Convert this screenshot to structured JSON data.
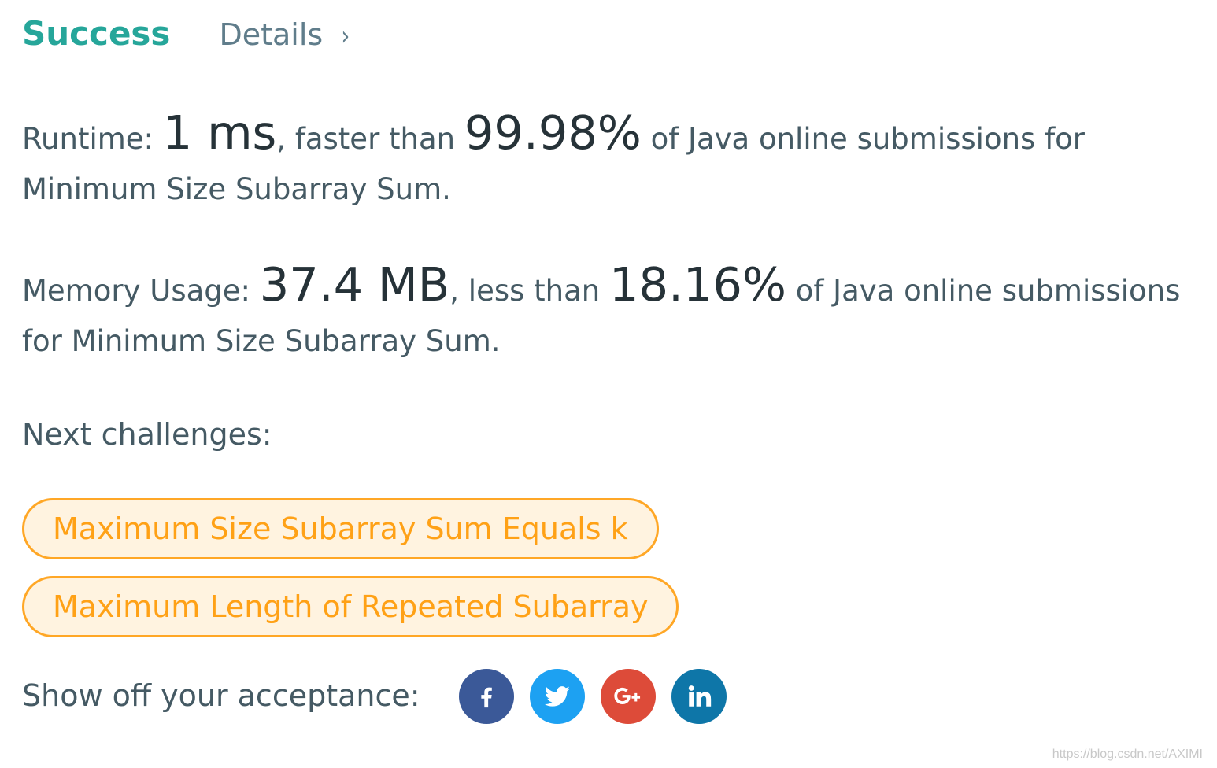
{
  "header": {
    "status": "Success",
    "details_label": "Details",
    "chevron": "›"
  },
  "runtime": {
    "prefix": "Runtime: ",
    "value": "1 ms",
    "middle": ", faster than ",
    "percent": "99.98%",
    "suffix": " of Java online submissions for Minimum Size Subarray Sum."
  },
  "memory": {
    "prefix": "Memory Usage: ",
    "value": "37.4 MB",
    "middle": ", less than ",
    "percent": "18.16%",
    "suffix": " of Java online submissions for Minimum Size Subarray Sum."
  },
  "next": {
    "label": "Next challenges:",
    "challenges": [
      "Maximum Size Subarray Sum Equals k",
      "Maximum Length of Repeated Subarray"
    ]
  },
  "share": {
    "label": "Show off your acceptance:",
    "buttons": [
      {
        "icon": "facebook-icon",
        "color": "#3b5998"
      },
      {
        "icon": "twitter-icon",
        "color": "#1da1f2"
      },
      {
        "icon": "google-plus-icon",
        "color": "#dd4b39"
      },
      {
        "icon": "linkedin-icon",
        "color": "#0e76a8"
      }
    ]
  },
  "watermark": "https://blog.csdn.net/AXIMI",
  "colors": {
    "success": "#26a69a",
    "challenge_text": "#ffa116",
    "challenge_border": "#ffa726",
    "challenge_bg": "#fff3e0"
  }
}
